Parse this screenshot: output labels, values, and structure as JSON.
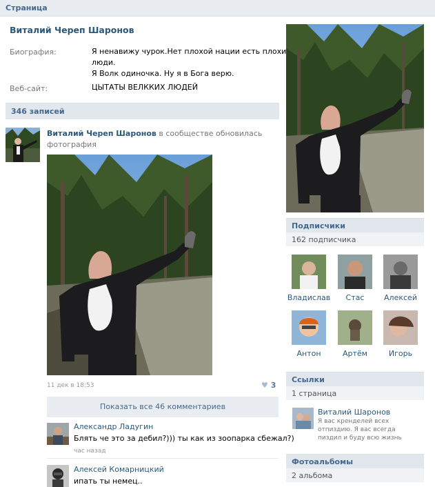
{
  "topbar": {
    "title": "Страница"
  },
  "profile": {
    "name": "Виталий Череп Шаронов",
    "bio_label": "Биография:",
    "bio_line1": "Я ненавижу чурок.Нет плохой нации есть плохие",
    "bio_line2": "люди.",
    "bio_line3": "Я Волк одиночка. Ну я в Бога верю.",
    "site_label": "Веб-сайт:",
    "site_value": "ЦЫТАТЫ ВЕЛККИХ ЛЮДЕЙ"
  },
  "wall": {
    "count_label": "346 записей",
    "post": {
      "author": "Виталий Череп Шаронов",
      "action1": " в сообществе обновилась",
      "action2": "фотография",
      "date": "11 дек в 18:53",
      "likes": "3",
      "show_comments": "Показать все 46 комментариев"
    },
    "comments": [
      {
        "author": "Александр Ладугин",
        "text": "Блять че это за дебил?))) ты как из зоопарка сбежал?)",
        "time": "час назад"
      },
      {
        "author": "Алексей Комарницкий",
        "text": "ипать ты немец.."
      }
    ]
  },
  "sidebar": {
    "followers_title": "Подписчики",
    "followers_count": "162 подписчика",
    "followers": [
      {
        "name": "Владислав"
      },
      {
        "name": "Стас"
      },
      {
        "name": "Алексей"
      },
      {
        "name": "Антон"
      },
      {
        "name": "Артём"
      },
      {
        "name": "Игорь"
      }
    ],
    "links_title": "Ссылки",
    "links_count": "1 страница",
    "link_item": {
      "name": "Виталий Шаронов",
      "desc1": "Я вас кренделей всех",
      "desc2": "отпиздию. Я вас всегда",
      "desc3": "пиздил и буду всю жизнь"
    },
    "albums_title": "Фотоальбомы",
    "albums_count": "2 альбома"
  },
  "colors": {
    "accent": "#45688e",
    "link": "#2b587a",
    "bar_bg": "#e1e7ed"
  }
}
